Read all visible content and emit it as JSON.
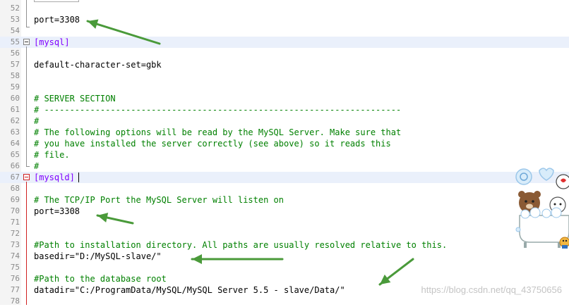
{
  "editor": {
    "lines": [
      {
        "num": "52",
        "text": "",
        "style": "code"
      },
      {
        "num": "53",
        "text": "port=3308",
        "style": "code"
      },
      {
        "num": "54",
        "text": "",
        "style": "code"
      },
      {
        "num": "55",
        "text": "[mysql]",
        "style": "section"
      },
      {
        "num": "56",
        "text": "",
        "style": "code"
      },
      {
        "num": "57",
        "text": "default-character-set=gbk",
        "style": "code"
      },
      {
        "num": "58",
        "text": "",
        "style": "code"
      },
      {
        "num": "59",
        "text": "",
        "style": "code"
      },
      {
        "num": "60",
        "text": "# SERVER SECTION",
        "style": "comment"
      },
      {
        "num": "61",
        "text": "# ----------------------------------------------------------------------",
        "style": "comment"
      },
      {
        "num": "62",
        "text": "#",
        "style": "comment"
      },
      {
        "num": "63",
        "text": "# The following options will be read by the MySQL Server. Make sure that",
        "style": "comment"
      },
      {
        "num": "64",
        "text": "# you have installed the server correctly (see above) so it reads this",
        "style": "comment"
      },
      {
        "num": "65",
        "text": "# file.",
        "style": "comment"
      },
      {
        "num": "66",
        "text": "#",
        "style": "comment"
      },
      {
        "num": "67",
        "text": "[mysqld]",
        "style": "section"
      },
      {
        "num": "68",
        "text": "",
        "style": "code"
      },
      {
        "num": "69",
        "text": "# The TCP/IP Port the MySQL Server will listen on",
        "style": "comment"
      },
      {
        "num": "70",
        "text": "port=3308",
        "style": "code"
      },
      {
        "num": "71",
        "text": "",
        "style": "code"
      },
      {
        "num": "72",
        "text": "",
        "style": "code"
      },
      {
        "num": "73",
        "text": "#Path to installation directory. All paths are usually resolved relative to this.",
        "style": "comment"
      },
      {
        "num": "74",
        "text": "basedir=\"D:/MySQL-slave/\"",
        "style": "code"
      },
      {
        "num": "75",
        "text": "",
        "style": "code"
      },
      {
        "num": "76",
        "text": "#Path to the database root",
        "style": "comment"
      },
      {
        "num": "77",
        "text": "datadir=\"C:/ProgramData/MySQL/MySQL Server 5.5 - slave/Data/\"",
        "style": "code"
      },
      {
        "num": "78",
        "text": "",
        "style": "code"
      }
    ]
  },
  "watermark": "https://blog.csdn.net/qq_43750656",
  "colors": {
    "arrow": "#4a9a3a",
    "comment": "#008000",
    "section": "#8000ff",
    "current_line": "#eaf0fb"
  }
}
